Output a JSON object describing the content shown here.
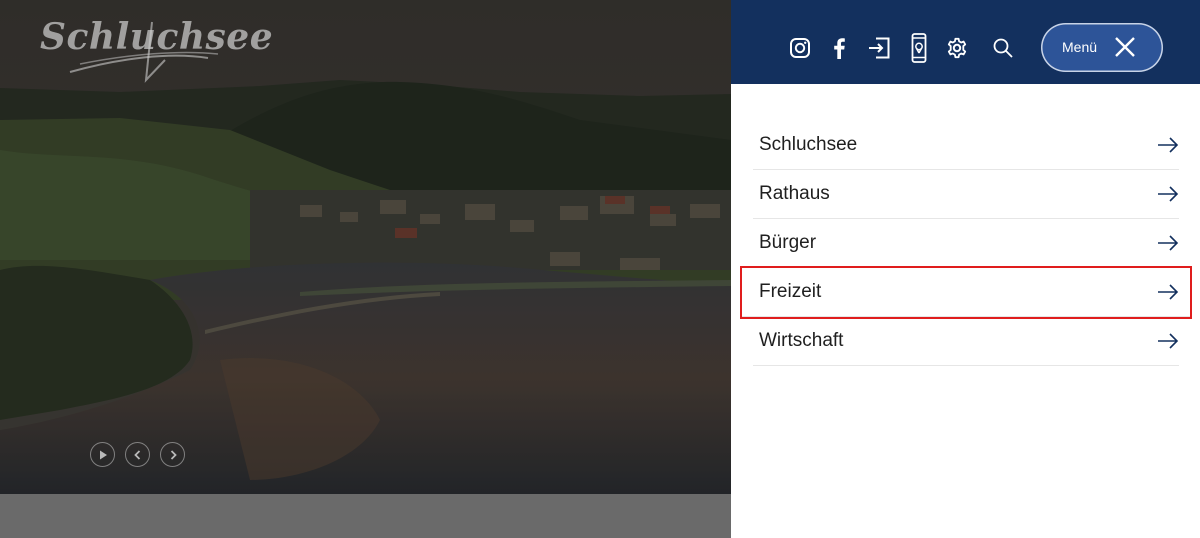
{
  "logo": {
    "text": "Schluchsee"
  },
  "toolbar": {
    "icons": [
      "instagram-icon",
      "facebook-icon",
      "login-icon",
      "mobile-location-icon",
      "gear-icon",
      "search-icon"
    ],
    "menu_label": "Menü"
  },
  "menu": {
    "items": [
      {
        "label": "Schluchsee"
      },
      {
        "label": "Rathaus"
      },
      {
        "label": "Bürger"
      },
      {
        "label": "Freizeit"
      },
      {
        "label": "Wirtschaft"
      }
    ]
  },
  "slider": {
    "controls": [
      "play-icon",
      "chevron-left-icon",
      "chevron-right-icon"
    ]
  },
  "colors": {
    "header_bg": "#13305e",
    "menu_button_bg": "#2d5498",
    "highlight_border": "#e01d1d",
    "menu_text": "#1f1f1f"
  }
}
